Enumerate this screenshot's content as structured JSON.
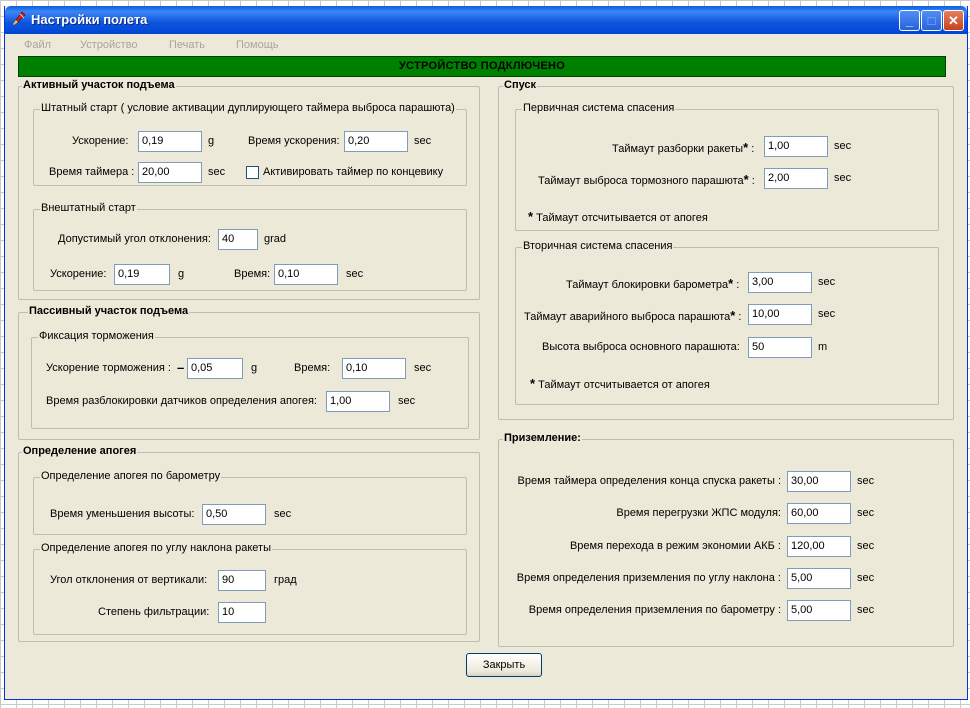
{
  "window": {
    "title": "Настройки полета",
    "controls": {
      "minimize": "_",
      "maximize": "□",
      "close": "✕"
    }
  },
  "menu": [
    "Файл",
    "Устройство",
    "Печать",
    "Помощь"
  ],
  "status": "УСТРОЙСТВО ПОДКЛЮЧЕНО",
  "active_ascent": {
    "title": "Активный участок подъема",
    "nominal": {
      "title": "Штатный старт ( условие активации дуплирующего таймера выброса парашюта)",
      "accel_label": "Ускорение:",
      "accel_value": "0,19",
      "accel_unit": "g",
      "accel_time_label": "Время ускорения:",
      "accel_time_value": "0,20",
      "accel_time_unit": "sec",
      "timer_label": "Время таймера :",
      "timer_value": "20,00",
      "timer_unit": "sec",
      "limit_switch_label": "Активировать таймер по концевику"
    },
    "abnormal": {
      "title": "Внештатный старт",
      "angle_label": "Допустимый угол отклонения:",
      "angle_value": "40",
      "angle_unit": "grad",
      "accel_label": "Ускорение:",
      "accel_value": "0,19",
      "accel_unit": "g",
      "time_label": "Время:",
      "time_value": "0,10",
      "time_unit": "sec"
    }
  },
  "passive_ascent": {
    "title": "Пассивный участок подъема",
    "braking": {
      "title": "Фиксация торможения",
      "decel_label": "Ускорение торможения :",
      "decel_sign": "–",
      "decel_value": "0,05",
      "decel_unit": "g",
      "time_label": "Время:",
      "time_value": "0,10",
      "time_unit": "sec",
      "unlock_label": "Время разблокировки датчиков определения апогея:",
      "unlock_value": "1,00",
      "unlock_unit": "sec"
    }
  },
  "apogee": {
    "title": "Определение апогея",
    "baro": {
      "title": "Определение апогея по барометру",
      "label": "Время уменьшения высоты:",
      "value": "0,50",
      "unit": "sec"
    },
    "angle": {
      "title": "Определение апогея по углу наклона ракеты",
      "angle_label": "Угол отклонения от вертикали:",
      "angle_value": "90",
      "angle_unit": "град",
      "filter_label": "Степень фильтрации:",
      "filter_value": "10"
    }
  },
  "descent": {
    "title": "Спуск",
    "primary": {
      "title": "Первичная система спасения",
      "sep_label": "Таймаут разборки ракеты",
      "sep_value": "1,00",
      "sep_unit": "sec",
      "drogue_label": "Таймаут выброса тормозного парашюта",
      "drogue_value": "2,00",
      "drogue_unit": "sec",
      "note": "Таймаут отсчитывается от апогея"
    },
    "secondary": {
      "title": "Вторичная система спасения",
      "baro_lock_label": "Таймаут блокировки барометра",
      "baro_lock_value": "3,00",
      "baro_lock_unit": "sec",
      "emergency_label": "Таймаут аварийного выброса парашюта",
      "emergency_value": "10,00",
      "emergency_unit": "sec",
      "height_label": "Высота выброса основного парашюта:",
      "height_value": "50",
      "height_unit": "m",
      "note": "Таймаут отсчитывается от апогея"
    },
    "star": "*",
    "colon": ":"
  },
  "landing": {
    "title": "Приземление:",
    "rows": [
      {
        "label": "Время таймера определения конца спуска ракеты :",
        "value": "30,00",
        "unit": "sec"
      },
      {
        "label": "Время перегрузки ЖПС модуля:",
        "value": "60,00",
        "unit": "sec"
      },
      {
        "label": "Время перехода в режим экономии АКБ :",
        "value": "120,00",
        "unit": "sec"
      },
      {
        "label": "Время определения приземления по углу наклона :",
        "value": "5,00",
        "unit": "sec"
      },
      {
        "label": "Время определения приземления по барометру :",
        "value": "5,00",
        "unit": "sec"
      }
    ]
  },
  "close_button": "Закрыть"
}
